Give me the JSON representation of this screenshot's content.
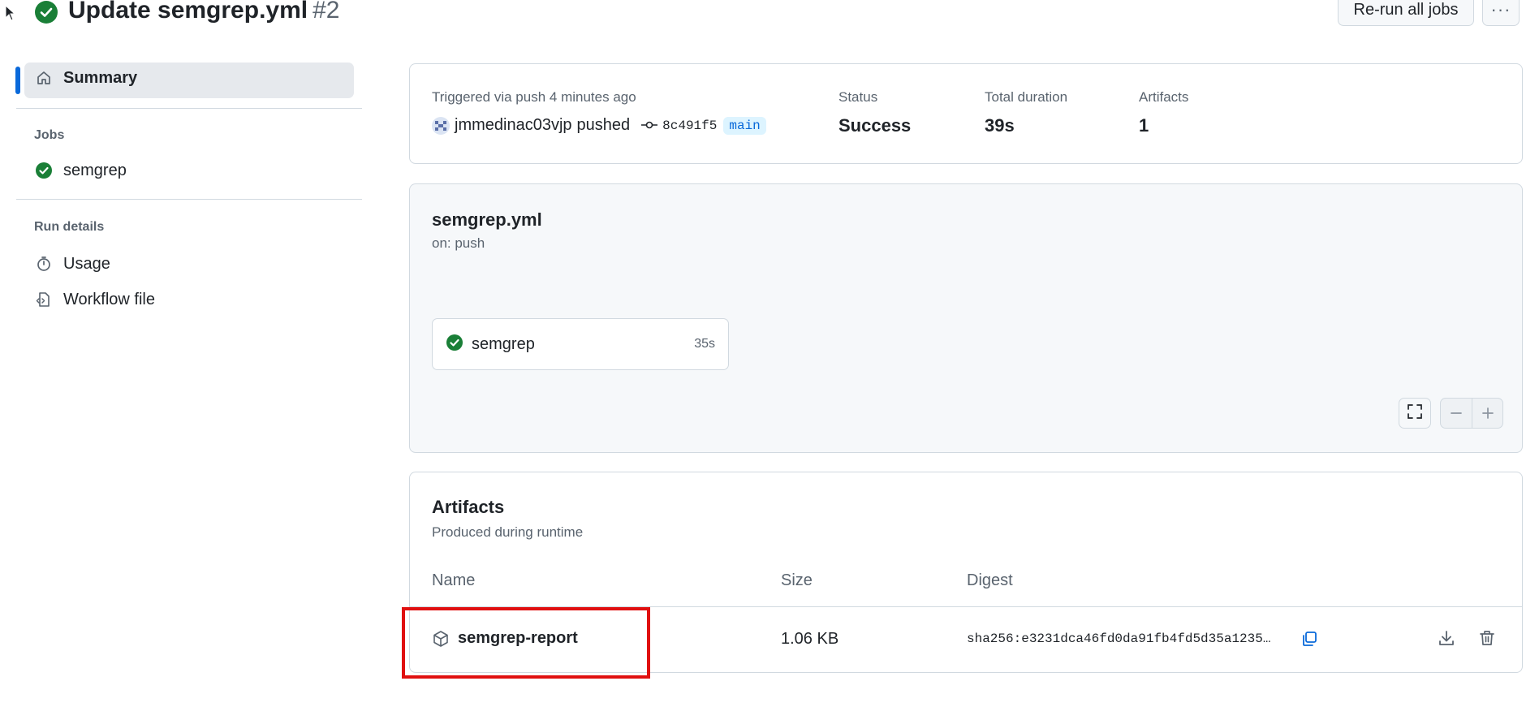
{
  "header": {
    "title": "Update semgrep.yml",
    "run_number": "#2",
    "rerun_label": "Re-run all jobs",
    "more_label": "···"
  },
  "sidebar": {
    "summary_label": "Summary",
    "jobs_heading": "Jobs",
    "jobs": [
      {
        "label": "semgrep",
        "status": "success"
      }
    ],
    "run_details_heading": "Run details",
    "run_details": [
      {
        "label": "Usage",
        "icon": "stopwatch-icon"
      },
      {
        "label": "Workflow file",
        "icon": "file-code-icon"
      }
    ]
  },
  "summary_card": {
    "trigger_text": "Triggered via push 4 minutes ago",
    "user": "jmmedinac03vjp",
    "action": "pushed",
    "commit_sha": "8c491f5",
    "branch": "main",
    "status_label": "Status",
    "status_value": "Success",
    "duration_label": "Total duration",
    "duration_value": "39s",
    "artifacts_label": "Artifacts",
    "artifacts_value": "1"
  },
  "workflow_card": {
    "name": "semgrep.yml",
    "trigger": "on: push",
    "jobs": [
      {
        "name": "semgrep",
        "duration": "35s",
        "status": "success"
      }
    ]
  },
  "artifacts": {
    "title": "Artifacts",
    "subtitle": "Produced during runtime",
    "columns": [
      "Name",
      "Size",
      "Digest"
    ],
    "rows": [
      {
        "name": "semgrep-report",
        "size": "1.06 KB",
        "digest": "sha256:e3231dca46fd0da91fb4fd5d35a1235…"
      }
    ]
  },
  "colors": {
    "accent": "#0969da",
    "success": "#1a7f37",
    "highlight": "#e01010",
    "border": "#d1d9e0"
  }
}
